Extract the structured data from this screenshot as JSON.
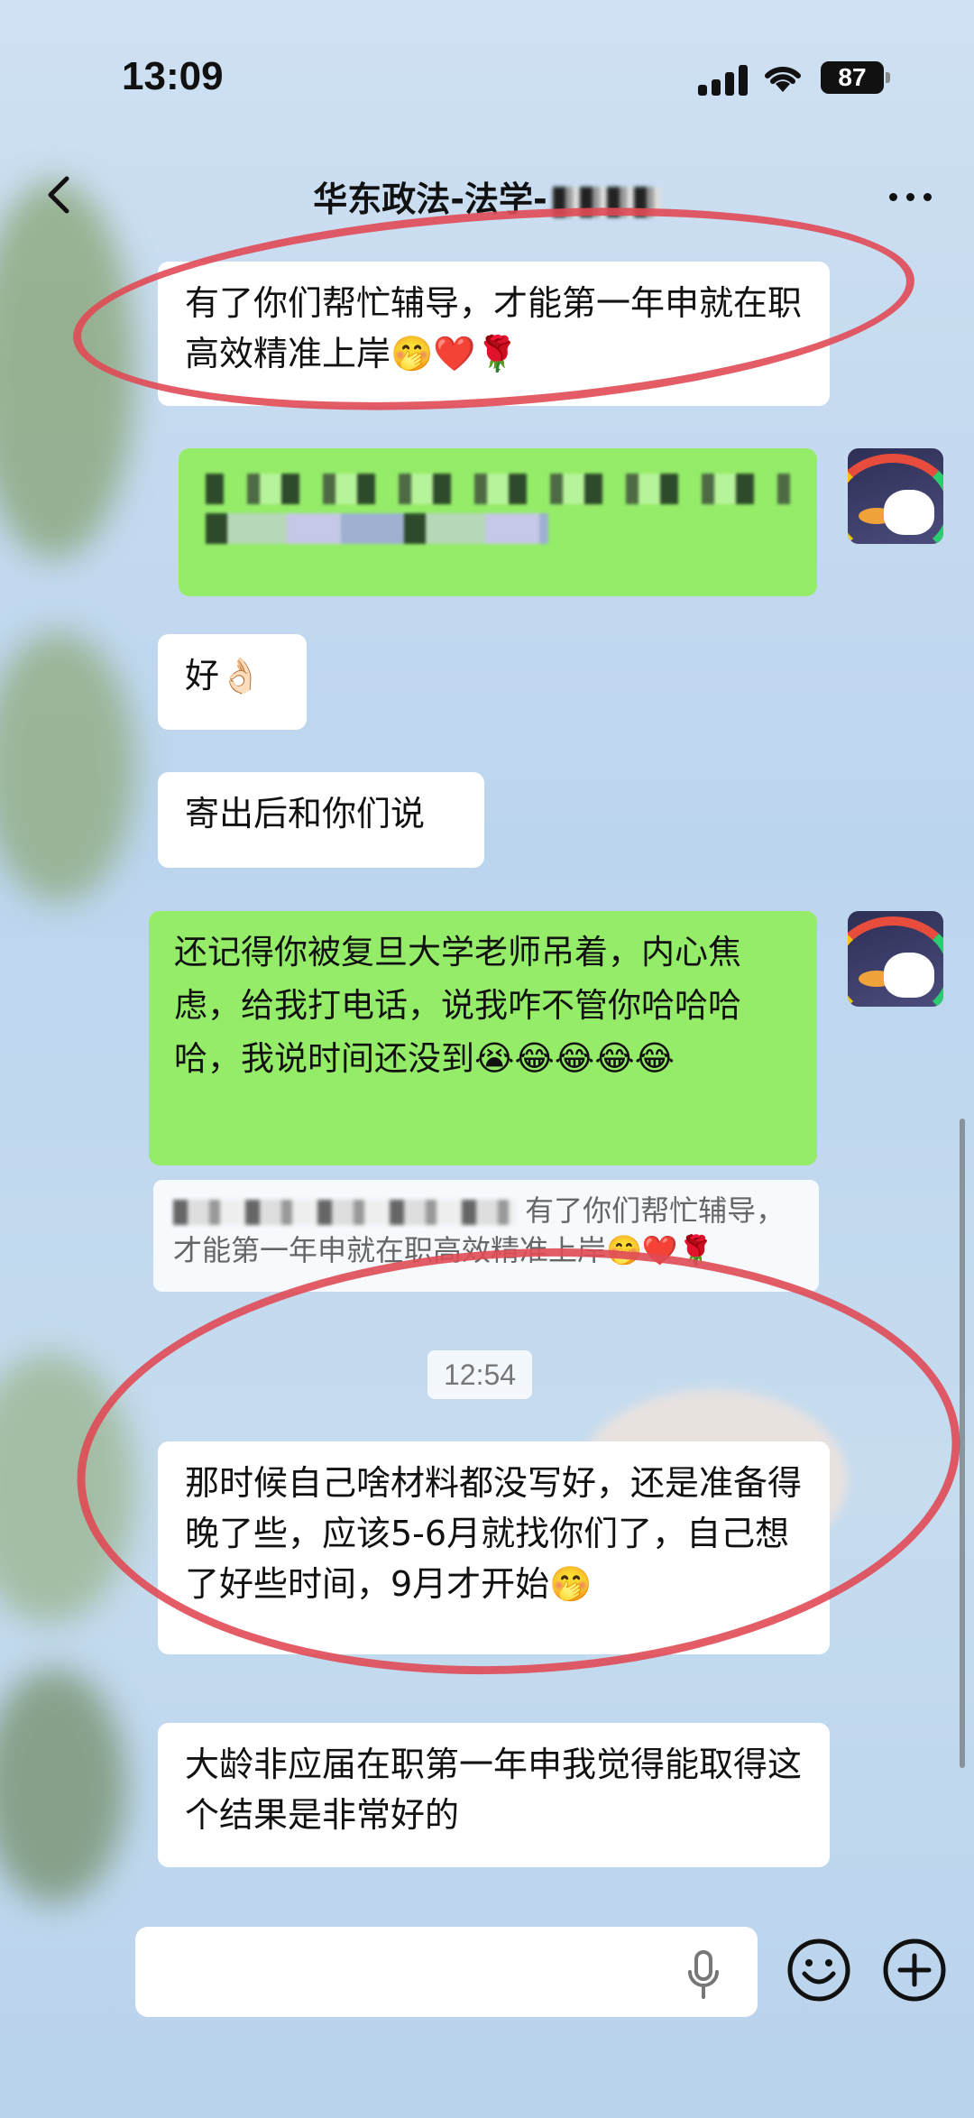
{
  "status_bar": {
    "time": "13:09",
    "battery": "87"
  },
  "nav": {
    "title": "华东政法-法学-"
  },
  "messages": {
    "m1": {
      "text": "有了你们帮忙辅导，才能第一年申就在职高效精准上岸",
      "emoji": "🤭❤️🌹"
    },
    "m3": {
      "text": "好",
      "emoji": "👌🏻"
    },
    "m4": {
      "text": "寄出后和你们说"
    },
    "m5": {
      "text": "还记得你被复旦大学老师吊着，内心焦虑，给我打电话，说我咋不管你哈哈哈哈，我说时间还没到",
      "emoji": "😭😂😂😂😂"
    },
    "quote": {
      "text": "有了你们帮忙辅导，",
      "text2": "才能第一年申就在职高效精准上岸",
      "emoji": "🤭❤️🌹"
    },
    "timestamp": "12:54",
    "m6": {
      "text": "那时候自己啥材料都没写好，还是准备得晚了些，应该5-6月就找你们了，自己想了好些时间，9月才开始",
      "emoji": "🤭"
    },
    "m7": {
      "text": "大龄非应届在职第一年申我觉得能取得这个结果是非常好的"
    }
  },
  "colors": {
    "green_bubble": "#95ec69",
    "annotation_red": "#e04a55"
  },
  "icons": [
    "back-icon",
    "more-icon",
    "mic-icon",
    "emoji-icon",
    "plus-icon"
  ]
}
